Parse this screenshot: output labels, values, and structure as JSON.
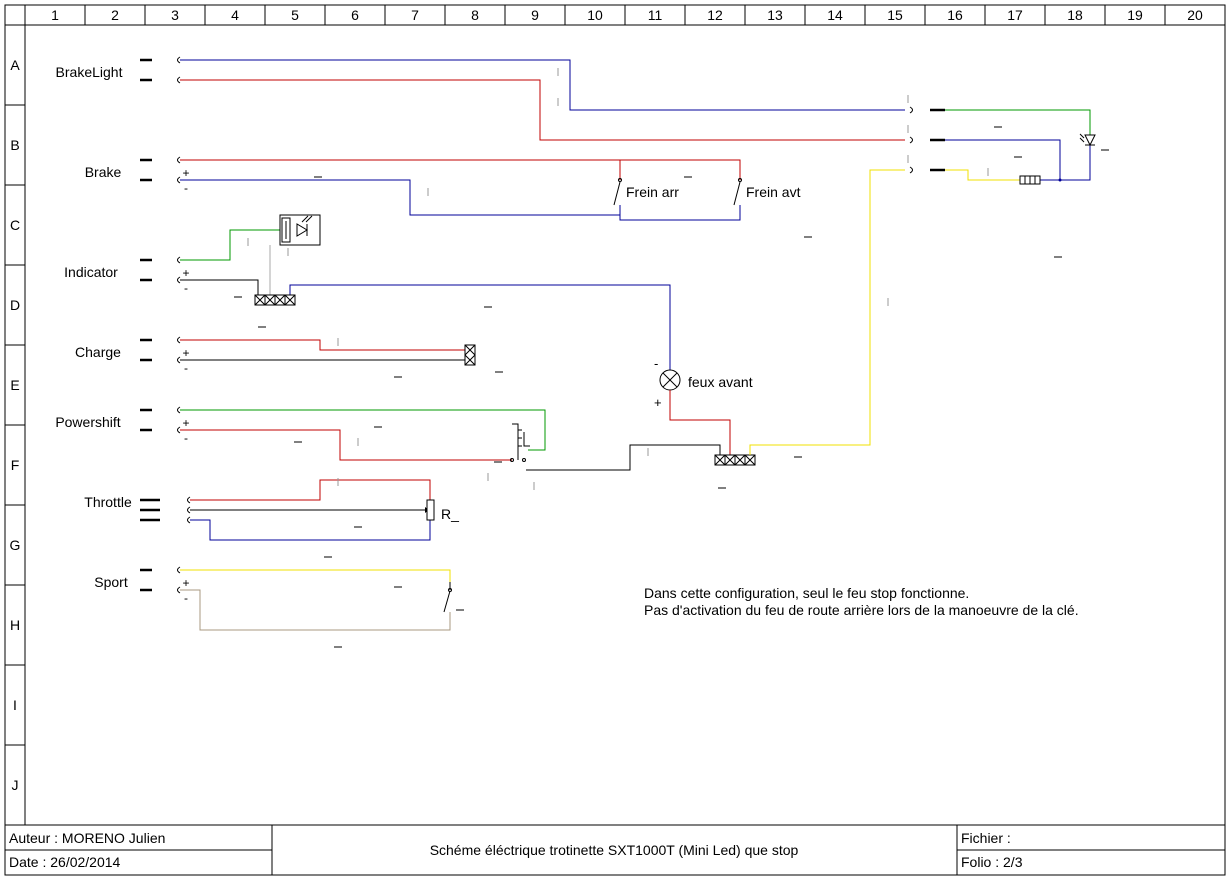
{
  "columns": [
    "1",
    "2",
    "3",
    "4",
    "5",
    "6",
    "7",
    "8",
    "9",
    "10",
    "11",
    "12",
    "13",
    "14",
    "15",
    "16",
    "17",
    "18",
    "19",
    "20"
  ],
  "rows": [
    "A",
    "B",
    "C",
    "D",
    "E",
    "F",
    "G",
    "H",
    "I",
    "J"
  ],
  "connectors": {
    "brakelight": "BrakeLight",
    "brake": "Brake",
    "indicator": "Indicator",
    "charge": "Charge",
    "powershift": "Powershift",
    "throttle": "Throttle",
    "sport": "Sport"
  },
  "labels": {
    "frein_arr": "Frein arr",
    "frein_avt": "Frein avt",
    "feux_avant": "feux avant",
    "resistor": "R_",
    "plus": "+",
    "minus": "-"
  },
  "note": {
    "line1": "Dans cette configuration, seul le feu stop fonctionne.",
    "line2": "Pas d'activation du feu de route arrière lors de la manoeuvre de la clé."
  },
  "title_block": {
    "author": "Auteur : MORENO Julien",
    "date": "Date : 26/02/2014",
    "title": "Schéme éléctrique trotinette SXT1000T (Mini Led) que stop",
    "file": "Fichier :",
    "folio": "Folio : 2/3"
  },
  "colors": {
    "red": "#c00000",
    "blue": "#000099",
    "green": "#009900",
    "black": "#000000",
    "yellow": "#f0e000",
    "tan": "#a89880",
    "grey": "#aaaaaa"
  }
}
